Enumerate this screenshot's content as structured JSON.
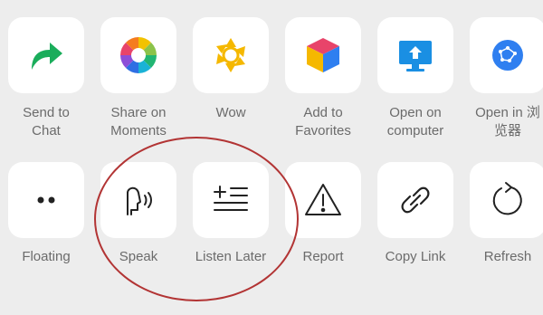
{
  "row1": [
    {
      "name": "send-to-chat-button",
      "icon": "share-arrow-icon",
      "label": "Send to\nChat"
    },
    {
      "name": "share-on-moments-button",
      "icon": "moments-aperture-icon",
      "label": "Share on\nMoments"
    },
    {
      "name": "wow-button",
      "icon": "wow-star-icon",
      "label": "Wow"
    },
    {
      "name": "add-to-favorites-button",
      "icon": "favorites-cube-icon",
      "label": "Add to\nFavorites"
    },
    {
      "name": "open-on-computer-button",
      "icon": "computer-monitor-icon",
      "label": "Open on\ncomputer"
    },
    {
      "name": "open-in-browser-button",
      "icon": "browser-globe-icon",
      "label": "Open in 浏\n览器"
    }
  ],
  "row2": [
    {
      "name": "floating-button",
      "icon": "floating-dots-icon",
      "label": "Floating"
    },
    {
      "name": "speak-button",
      "icon": "speak-head-icon",
      "label": "Speak"
    },
    {
      "name": "listen-later-button",
      "icon": "listen-later-icon",
      "label": "Listen Later"
    },
    {
      "name": "report-button",
      "icon": "warning-triangle-icon",
      "label": "Report"
    },
    {
      "name": "copy-link-button",
      "icon": "link-icon",
      "label": "Copy Link"
    },
    {
      "name": "refresh-button",
      "icon": "refresh-icon",
      "label": "Refresh"
    }
  ],
  "colors": {
    "background": "#ededed",
    "tile": "#ffffff",
    "label": "#6b6b6b",
    "send_green": "#1aad5b",
    "monitor_blue": "#1a8fe3",
    "globe_blue": "#2f7ff0",
    "wow_yellow": "#f5b800",
    "annotation_red": "#b23434"
  }
}
